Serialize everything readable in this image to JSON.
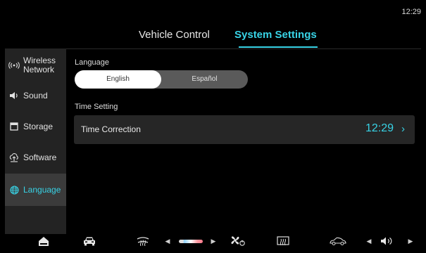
{
  "status": {
    "time": "12:29"
  },
  "tabs": [
    {
      "label": "Vehicle Control"
    },
    {
      "label": "System Settings"
    }
  ],
  "sidebar": {
    "items": [
      {
        "label_line1": "Wireless",
        "label_line2": "Network",
        "icon": "wireless-icon"
      },
      {
        "label": "Sound",
        "icon": "speaker-icon"
      },
      {
        "label": "Storage",
        "icon": "storage-icon"
      },
      {
        "label": "Software",
        "icon": "software-icon"
      },
      {
        "label": "Language",
        "icon": "globe-icon"
      }
    ],
    "active": "Language"
  },
  "language": {
    "heading": "Language",
    "options": [
      "English",
      "Español"
    ],
    "selected": "English"
  },
  "time_setting": {
    "heading": "Time Setting",
    "row_label": "Time Correction",
    "value": "12:29",
    "chevron": "›"
  },
  "bottombar": {
    "icons": [
      "home-icon",
      "car-icon",
      "rear-defrost-icon",
      "fan-icon",
      "front-defrost-icon",
      "car-side-icon",
      "volume-icon"
    ]
  },
  "colors": {
    "accent": "#38d3e6",
    "sidebar_bg": "#232323",
    "active_bg": "#3b3b3b"
  }
}
